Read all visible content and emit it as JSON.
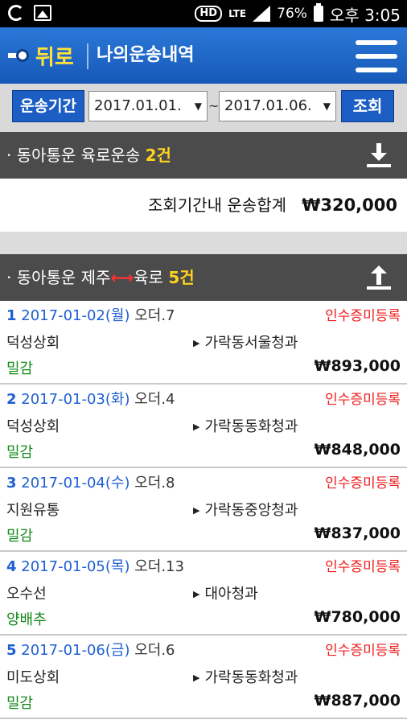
{
  "status_bar": {
    "lte": "LTE",
    "battery": "76%",
    "time": "오후 3:05"
  },
  "header": {
    "back_label": "뒤로",
    "title": "나의운송내역"
  },
  "filter": {
    "period_label": "운송기간",
    "date_from": "2017.01.01.",
    "date_to": "2017.01.06.",
    "separator": "~",
    "search_label": "조회"
  },
  "sections": {
    "land": {
      "title": "· 동아통운 육로운송",
      "count": "2건",
      "total_label": "조회기간내 운송합계",
      "total_value": "₩320,000"
    },
    "jeju": {
      "title_prefix": "· 동아통운 제주",
      "arrow": "⟷",
      "title_suffix": "육로",
      "count": "5건"
    }
  },
  "orders": [
    {
      "no": "1",
      "date": "2017-01-02(월)",
      "order": "오더.7",
      "status": "인수증미등록",
      "shipper": "덕성상회",
      "dest": "가락동서울청과",
      "note": "밀감",
      "amount": "₩893,000"
    },
    {
      "no": "2",
      "date": "2017-01-03(화)",
      "order": "오더.4",
      "status": "인수증미등록",
      "shipper": "덕성상회",
      "dest": "가락동동화청과",
      "note": "밀감",
      "amount": "₩848,000"
    },
    {
      "no": "3",
      "date": "2017-01-04(수)",
      "order": "오더.8",
      "status": "인수증미등록",
      "shipper": "지원유통",
      "dest": "가락동중앙청과",
      "note": "밀감",
      "amount": "₩837,000"
    },
    {
      "no": "4",
      "date": "2017-01-05(목)",
      "order": "오더.13",
      "status": "인수증미등록",
      "shipper": "오수선",
      "dest": "대아청과",
      "note": "양배추",
      "amount": "₩780,000"
    },
    {
      "no": "5",
      "date": "2017-01-06(금)",
      "order": "오더.6",
      "status": "인수증미등록",
      "shipper": "미도상회",
      "dest": "가락동동화청과",
      "note": "밀감",
      "amount": "₩887,000"
    }
  ],
  "icons": {
    "back": "back-key-icon",
    "menu": "hamburger-menu-icon",
    "collapse_land": "download-icon",
    "collapse_jeju": "upload-icon"
  },
  "colors": {
    "header_blue": "#1c5ec4",
    "back_yellow": "#ffe13a",
    "count_yellow": "#ffd21f",
    "status_red": "#ef1c1c",
    "note_green": "#138a18",
    "date_blue": "#1e5fd3"
  }
}
